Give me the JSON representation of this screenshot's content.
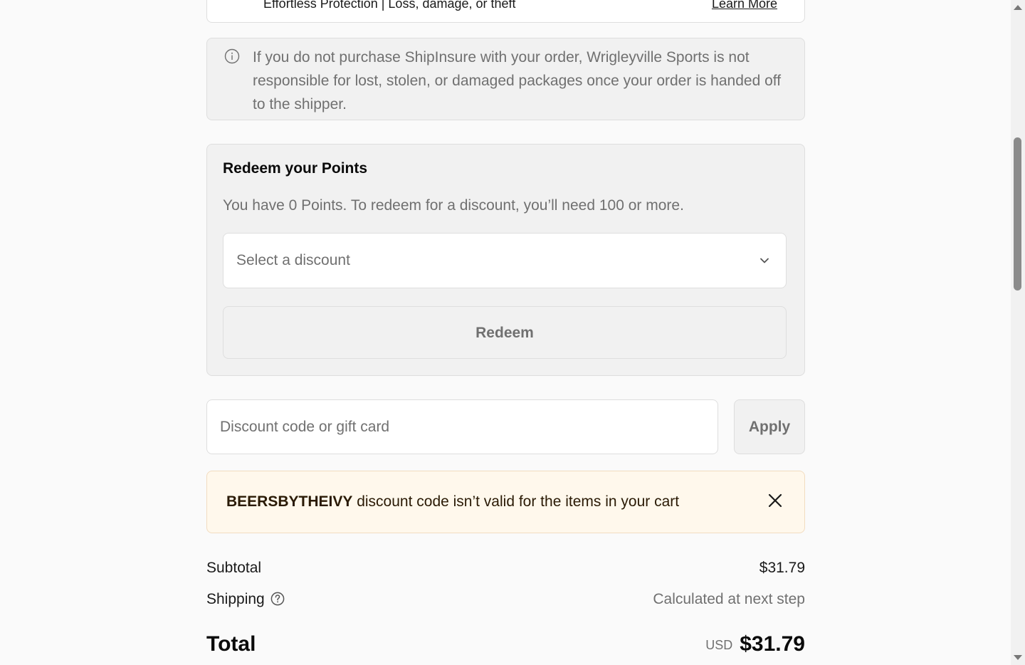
{
  "protection": {
    "text": "Effortless Protection | Loss, damage, or theft",
    "link_label": "Learn More"
  },
  "notice": {
    "icon": "info-circle-icon",
    "text": "If you do not purchase ShipInsure with your order, Wrigleyville Sports is not responsible for lost, stolen, or damaged packages once your order is handed off to the shipper."
  },
  "points": {
    "title": "Redeem your Points",
    "description": "You have 0 Points. To redeem for a discount, you’ll need 100 or more.",
    "select_placeholder": "Select a discount",
    "select_icon": "chevron-down-icon",
    "redeem_label": "Redeem"
  },
  "discount": {
    "placeholder": "Discount code or gift card",
    "value": "",
    "apply_label": "Apply"
  },
  "error_banner": {
    "code": "BEERSBYTHEIVY",
    "message": " discount code isn’t valid for the items in your cart",
    "close_icon": "close-icon",
    "background": "#fff8ec"
  },
  "summary": {
    "subtotal_label": "Subtotal",
    "subtotal_value": "$31.79",
    "shipping_label": "Shipping",
    "shipping_help_icon": "question-circle-icon",
    "shipping_value": "Calculated at next step",
    "total_label": "Total",
    "total_currency": "USD",
    "total_value": "$31.79"
  },
  "colors": {
    "muted_text": "#707070",
    "panel_bg": "#f1f1f1",
    "border": "#dedede"
  }
}
